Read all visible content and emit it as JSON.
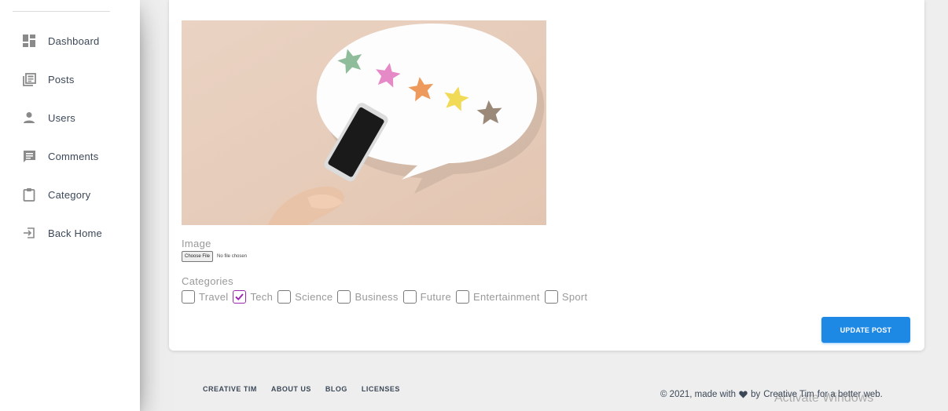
{
  "sidebar": {
    "items": [
      {
        "label": "Dashboard",
        "icon": "dashboard-icon"
      },
      {
        "label": "Posts",
        "icon": "posts-icon"
      },
      {
        "label": "Users",
        "icon": "person-icon"
      },
      {
        "label": "Comments",
        "icon": "comment-icon"
      },
      {
        "label": "Category",
        "icon": "clipboard-icon"
      },
      {
        "label": "Back Home",
        "icon": "login-arrow-icon"
      }
    ]
  },
  "form": {
    "image_label": "Image",
    "file_button": "Choose File",
    "file_status": "No file chosen",
    "categories_label": "Categories",
    "categories": [
      {
        "label": "Travel",
        "checked": false
      },
      {
        "label": "Tech",
        "checked": true
      },
      {
        "label": "Science",
        "checked": false
      },
      {
        "label": "Business",
        "checked": false
      },
      {
        "label": "Future",
        "checked": false
      },
      {
        "label": "Entertainment",
        "checked": false
      },
      {
        "label": "Sport",
        "checked": false
      }
    ],
    "submit_label": "UPDATE POST"
  },
  "footer": {
    "links": [
      "CREATIVE TIM",
      "ABOUT US",
      "BLOG",
      "LICENSES"
    ],
    "copyright_prefix": "© 2021, made with",
    "copyright_by": "by",
    "copyright_link": "Creative Tim",
    "copyright_suffix": "for a better web."
  },
  "watermark": "Activate Windows",
  "colors": {
    "accent": "#1e88e5",
    "checkbox_checked": "#9c27b0",
    "sidebar_icon": "#8a8a8a"
  }
}
